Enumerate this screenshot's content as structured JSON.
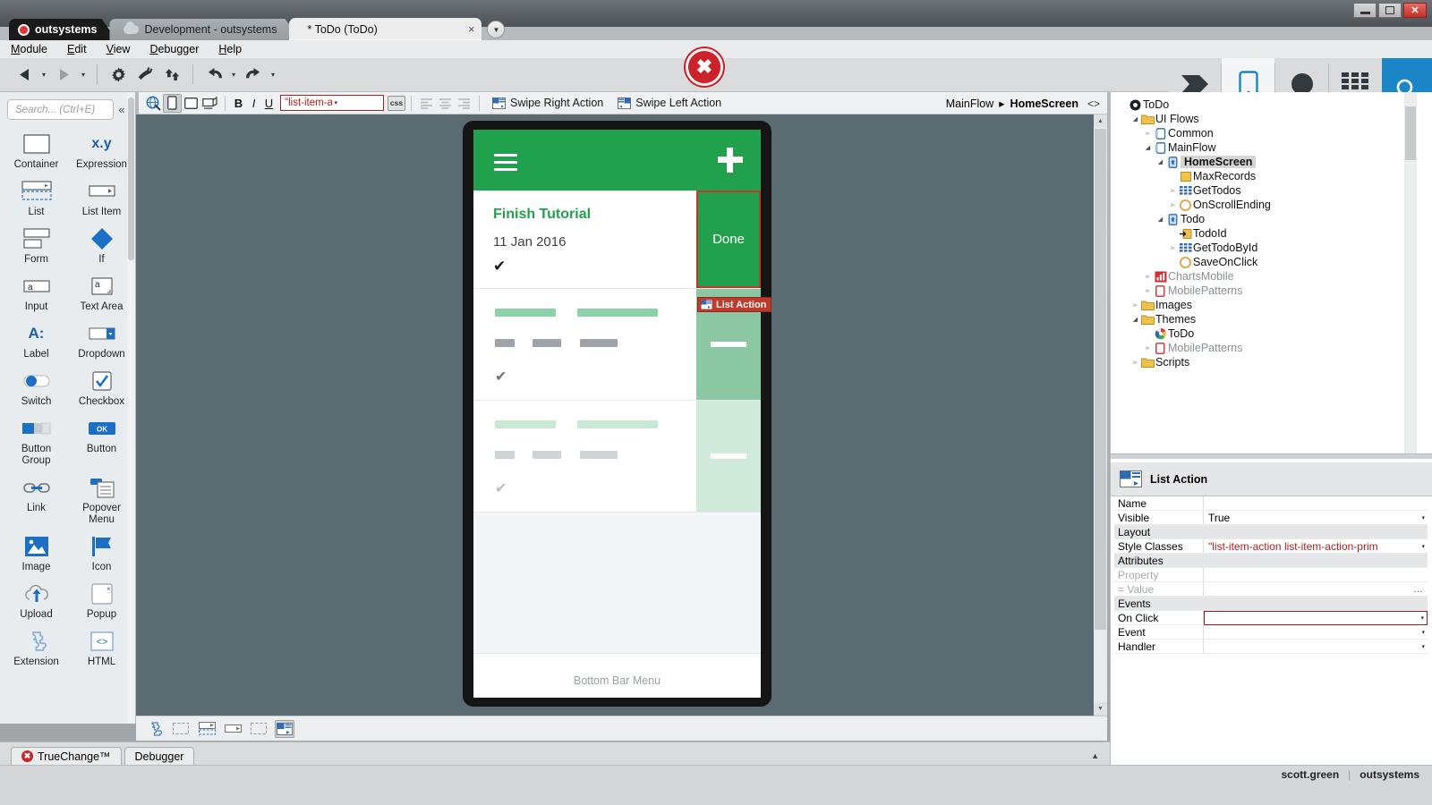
{
  "window": {
    "minimize_label": "Minimize",
    "restore_label": "Restore",
    "close_label": "✕"
  },
  "tabs": {
    "brand": "outsystems",
    "environment": "Development - outsystems",
    "module": "* ToDo (ToDo)",
    "close_glyph": "×",
    "dropdown_glyph": "▼"
  },
  "menu": [
    "Module",
    "Edit",
    "View",
    "Debugger",
    "Help"
  ],
  "toolbar": {
    "back_label": "Back",
    "forward_label": "Forward",
    "manage_dependencies_label": "Manage Dependencies",
    "debug_label": "Debug",
    "publish_label": "1-Click Publish",
    "undo_label": "Undo",
    "redo_label": "Redo",
    "caret_glyph": "▾",
    "error_glyph": "✖",
    "modes": [
      {
        "label": "Processes",
        "icon": "processes-icon",
        "selected": false
      },
      {
        "label": "Interface",
        "icon": "interface-icon",
        "selected": true
      },
      {
        "label": "Logic",
        "icon": "logic-icon",
        "selected": false
      },
      {
        "label": "Data",
        "icon": "data-icon",
        "selected": false
      }
    ],
    "search_icon": "search-icon"
  },
  "widget_toolbar": {
    "preview_icon": "preview-in-browser-icon",
    "phone_icon": "phone-portrait-icon",
    "tablet_icon": "tablet-icon",
    "desktop_icon": "desktop-icon",
    "bold": "B",
    "italic": "I",
    "underline": "U",
    "style_classes_value": "\"list-item-action li",
    "style_dropdown_glyph": "▾",
    "css_label": "css",
    "align_left": "align-left-icon",
    "align_center": "align-center-icon",
    "align_right": "align-right-icon",
    "swipe_right": "Swipe Right Action",
    "swipe_left": "Swipe Left Action",
    "breadcrumb_flow": "MainFlow",
    "breadcrumb_sep": "▸",
    "breadcrumb_screen": "HomeScreen",
    "code_glyph": "<>"
  },
  "palette": {
    "search_placeholder": "Search... (Ctrl+E)",
    "collapse_glyph": "«",
    "widgets": [
      {
        "label": "Container",
        "icon": "container-icon"
      },
      {
        "label": "Expression",
        "icon": "expression-icon",
        "text": "x.y"
      },
      {
        "label": "List",
        "icon": "list-icon"
      },
      {
        "label": "List Item",
        "icon": "list-item-icon"
      },
      {
        "label": "Form",
        "icon": "form-icon"
      },
      {
        "label": "If",
        "icon": "if-icon"
      },
      {
        "label": "Input",
        "icon": "input-icon",
        "text": "a"
      },
      {
        "label": "Text Area",
        "icon": "text-area-icon",
        "text": "a"
      },
      {
        "label": "Label",
        "icon": "label-icon",
        "text": "A:"
      },
      {
        "label": "Dropdown",
        "icon": "dropdown-icon"
      },
      {
        "label": "Switch",
        "icon": "switch-icon"
      },
      {
        "label": "Checkbox",
        "icon": "checkbox-icon"
      },
      {
        "label": "Button Group",
        "icon": "button-group-icon"
      },
      {
        "label": "Button",
        "icon": "button-icon",
        "text": "OK"
      },
      {
        "label": "Link",
        "icon": "link-icon"
      },
      {
        "label": "Popover Menu",
        "icon": "popover-menu-icon"
      },
      {
        "label": "Image",
        "icon": "image-icon"
      },
      {
        "label": "Icon",
        "icon": "icon-widget-icon"
      },
      {
        "label": "Upload",
        "icon": "upload-icon"
      },
      {
        "label": "Popup",
        "icon": "popup-icon"
      },
      {
        "label": "Extension",
        "icon": "extension-icon"
      },
      {
        "label": "HTML",
        "icon": "html-element-icon"
      }
    ]
  },
  "canvas": {
    "phone_screen": {
      "header": {
        "menu_icon": "hamburger-menu-icon",
        "add_icon": "plus-icon"
      },
      "list_item": {
        "title": "Finish Tutorial",
        "date": "11 Jan 2016",
        "check_glyph": "✔",
        "action_label": "Done"
      },
      "ghost_rows": 2,
      "bottom_bar_label": "Bottom Bar Menu"
    },
    "selection_badge": {
      "label": "List Action",
      "icon": "list-action-icon"
    },
    "footer_icons": [
      {
        "icon": "extension-breadcrumb-icon",
        "selected": false
      },
      {
        "icon": "container-breadcrumb-icon",
        "selected": false
      },
      {
        "icon": "list-breadcrumb-icon",
        "selected": false
      },
      {
        "icon": "list-item-breadcrumb-icon",
        "selected": false
      },
      {
        "icon": "container2-breadcrumb-icon",
        "selected": false
      },
      {
        "icon": "list-action-breadcrumb-icon",
        "selected": true
      }
    ]
  },
  "tree": {
    "nodes": [
      {
        "label": "ToDo",
        "depth": 0,
        "arrow": "",
        "icon": "module-icon",
        "dim": false,
        "sel": false
      },
      {
        "label": "UI Flows",
        "depth": 1,
        "arrow": "◢",
        "icon": "folder-icon",
        "dim": false,
        "sel": false
      },
      {
        "label": "Common",
        "depth": 2,
        "arrow": "▹",
        "icon": "flow-icon",
        "dim": false,
        "sel": false
      },
      {
        "label": "MainFlow",
        "depth": 2,
        "arrow": "◢",
        "icon": "flow-icon",
        "dim": false,
        "sel": false
      },
      {
        "label": "HomeScreen",
        "depth": 3,
        "arrow": "◢",
        "icon": "screen-icon",
        "dim": false,
        "sel": true
      },
      {
        "label": "MaxRecords",
        "depth": 4,
        "arrow": "",
        "icon": "variable-icon",
        "dim": false,
        "sel": false
      },
      {
        "label": "GetTodos",
        "depth": 4,
        "arrow": "▹",
        "icon": "aggregate-icon",
        "dim": false,
        "sel": false
      },
      {
        "label": "OnScrollEnding",
        "depth": 4,
        "arrow": "▹",
        "icon": "action-icon",
        "dim": false,
        "sel": false
      },
      {
        "label": "Todo",
        "depth": 3,
        "arrow": "◢",
        "icon": "screen-icon",
        "dim": false,
        "sel": false
      },
      {
        "label": "TodoId",
        "depth": 4,
        "arrow": "",
        "icon": "input-parameter-icon",
        "dim": false,
        "sel": false
      },
      {
        "label": "GetTodoById",
        "depth": 4,
        "arrow": "▹",
        "icon": "aggregate-icon",
        "dim": false,
        "sel": false
      },
      {
        "label": "SaveOnClick",
        "depth": 4,
        "arrow": "",
        "icon": "action-icon",
        "dim": false,
        "sel": false
      },
      {
        "label": "ChartsMobile",
        "depth": 2,
        "arrow": "▹",
        "icon": "charts-icon",
        "dim": true,
        "sel": false
      },
      {
        "label": "MobilePatterns",
        "depth": 2,
        "arrow": "▹",
        "icon": "patterns-icon",
        "dim": true,
        "sel": false
      },
      {
        "label": "Images",
        "depth": 1,
        "arrow": "▹",
        "icon": "folder-icon",
        "dim": false,
        "sel": false
      },
      {
        "label": "Themes",
        "depth": 1,
        "arrow": "◢",
        "icon": "folder-icon",
        "dim": false,
        "sel": false
      },
      {
        "label": "ToDo",
        "depth": 2,
        "arrow": "",
        "icon": "theme-icon",
        "dim": false,
        "sel": false
      },
      {
        "label": "MobilePatterns",
        "depth": 2,
        "arrow": "▹",
        "icon": "patterns-icon",
        "dim": true,
        "sel": false
      },
      {
        "label": "Scripts",
        "depth": 1,
        "arrow": "▹",
        "icon": "folder-icon",
        "dim": false,
        "sel": false
      }
    ]
  },
  "properties": {
    "header_title": "List Action",
    "header_icon": "list-action-icon",
    "rows": [
      {
        "type": "prop",
        "name": "Name",
        "value": "",
        "dropdown": false
      },
      {
        "type": "prop",
        "name": "Visible",
        "value": "True",
        "dropdown": true
      },
      {
        "type": "group",
        "name": "Layout"
      },
      {
        "type": "prop",
        "name": "Style Classes",
        "value": "\"list-item-action list-item-action-prim",
        "dropdown": true,
        "red": true
      },
      {
        "type": "group",
        "name": "Attributes"
      },
      {
        "type": "placeholder",
        "name": "Property",
        "value": ""
      },
      {
        "type": "placeholder",
        "name": "= Value",
        "value": "",
        "dots": true
      },
      {
        "type": "group",
        "name": "Events"
      },
      {
        "type": "prop",
        "name": "On Click",
        "value": "",
        "dropdown": true,
        "highlight": true
      },
      {
        "type": "prop",
        "name": "Event",
        "value": "",
        "dropdown": true
      },
      {
        "type": "prop",
        "name": "Handler",
        "value": "",
        "dropdown": true
      }
    ]
  },
  "bottom": {
    "truechange_label": "TrueChange™",
    "truechange_error_glyph": "✖",
    "debugger_label": "Debugger",
    "collapse_glyph": "▲"
  },
  "status": {
    "user": "scott.green",
    "separator": "|",
    "environment": "outsystems"
  },
  "colors": {
    "brand_green": "#21a04d",
    "selection_red": "#c0392b",
    "accent_blue": "#1b86c8",
    "error_red": "#cc2229"
  }
}
